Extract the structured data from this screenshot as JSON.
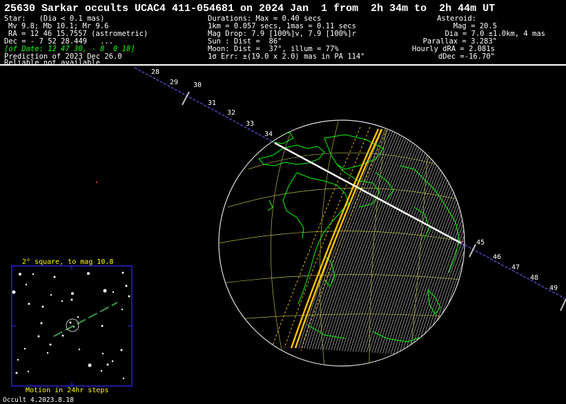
{
  "title": "25630 Sarkar occults UCAC4 411-054681 on 2024 Jan  1 from  2h 34m to  2h 44m UT",
  "star": {
    "heading": "Star:   (Dia < 0.1 mas)",
    "mags": "Mv 9.8; Mb 10.1; Mr 9.6",
    "ra": "RA = 12 46 15.7557 (astrometric)",
    "dec": "Dec = - 7 52 28.449   ...",
    "of_date": "[of Date: 12 47 30, - 8  0 18]",
    "prediction": "Prediction of 2023 Dec 26.0",
    "reliable": "Reliable not available"
  },
  "event": {
    "durations": "Durations: Max = 0.40 secs",
    "km_secs": "1km = 0.057 secs, 1mas = 0.11 secs",
    "mag_drop": "Mag Drop: 7.9 [100%]v, 7.9 [100%]r",
    "sun": "Sun : Dist =  86°",
    "moon": "Moon: Dist =  37°, illum = 77%",
    "err": "1σ Err: ±(19.0 x 2.0) mas in PA 114°"
  },
  "asteroid": {
    "heading": "Asteroid:",
    "mag": "Mag = 20.5",
    "dia": "Dia = 7.0 ±1.0km, 4 mas",
    "parallax": "Parallax = 3.283\"",
    "hourly_dra": "Hourly dRA = 2.081s",
    "ddec": "dDec =-16.70\""
  },
  "path_ticks_upper": [
    "28",
    "29",
    "30",
    "31",
    "32",
    "33",
    "34"
  ],
  "path_ticks_lower": [
    "45",
    "46",
    "47",
    "48",
    "49"
  ],
  "inset": {
    "caption_top": "2° square, to mag 10.8",
    "caption_bottom": "Motion in 24hr steps"
  },
  "footer": "Occult 4.2023.8.18",
  "colors": {
    "background": "#000000",
    "coastline": "#00ff00",
    "graticule": "#c8c850",
    "path_limit": "#ffc000",
    "shadow_path": "#ffffff",
    "inset_frame": "#3030ff"
  }
}
